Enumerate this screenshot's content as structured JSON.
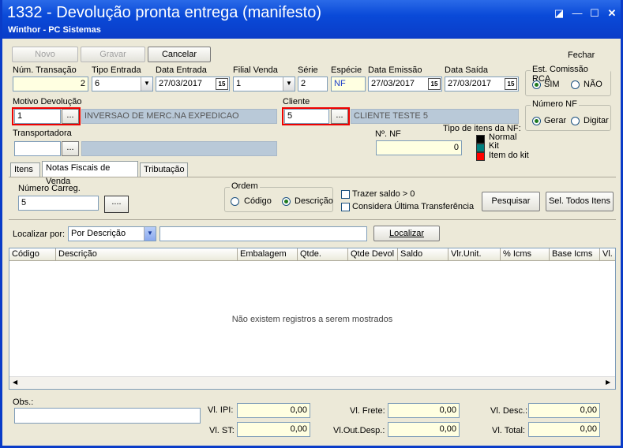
{
  "window": {
    "title": "1332 - Devolução pronta entrega (manifesto)",
    "subtitle": "Winthor - PC Sistemas"
  },
  "toolbar": {
    "novo": "Novo",
    "gravar": "Gravar",
    "cancelar": "Cancelar",
    "fechar": "Fechar"
  },
  "header": {
    "num_transacao_label": "Núm. Transação",
    "num_transacao_value": "2",
    "tipo_entrada_label": "Tipo Entrada",
    "tipo_entrada_value": "6",
    "data_entrada_label": "Data Entrada",
    "data_entrada_value": "27/03/2017",
    "filial_venda_label": "Filial Venda",
    "filial_venda_value": "1",
    "serie_label": "Série",
    "serie_value": "2",
    "especie_label": "Espécie",
    "especie_value": "NF",
    "data_emissao_label": "Data Emissão",
    "data_emissao_value": "27/03/2017",
    "data_saida_label": "Data Saída",
    "data_saida_value": "27/03/2017",
    "cal_icon": "15"
  },
  "comissao": {
    "title": "Est. Comissão RCA",
    "sim": "SIM",
    "nao": "NÃO"
  },
  "numero_nf_group": {
    "title": "Número NF",
    "gerar": "Gerar",
    "digitar": "Digitar"
  },
  "motivo": {
    "label": "Motivo Devolução",
    "code": "1",
    "desc": "INVERSAO DE MERC.NA EXPEDICAO",
    "btn": "..."
  },
  "cliente": {
    "label": "Cliente",
    "code": "5",
    "desc": "CLIENTE TESTE 5",
    "btn": "..."
  },
  "transportadora": {
    "label": "Transportadora",
    "code": "",
    "desc": "",
    "btn": "..."
  },
  "nf": {
    "label": "Nº. NF",
    "value": "0"
  },
  "tipo_itens": {
    "title": "Tipo de itens da NF:",
    "items": [
      {
        "label": "Normal",
        "color": "#000000"
      },
      {
        "label": "Kit",
        "color": "#008080"
      },
      {
        "label": "Item do kit",
        "color": "#ff0000"
      }
    ]
  },
  "tabs": [
    "Itens",
    "Notas Fiscais de Venda",
    "Tributação"
  ],
  "carreg": {
    "label": "Número Carreg.",
    "value": "5",
    "btn": "...."
  },
  "ordem": {
    "title": "Ordem",
    "codigo": "Código",
    "descricao": "Descrição"
  },
  "options": {
    "trazer_saldo": "Trazer saldo > 0",
    "considera_ultima": "Considera Última Transferência"
  },
  "buttons": {
    "pesquisar": "Pesquisar",
    "sel_todos": "Sel. Todos Itens",
    "localizar": "Localizar"
  },
  "localizar": {
    "label": "Localizar por:",
    "selected": "Por Descrição",
    "value": ""
  },
  "grid": {
    "columns": [
      "Código",
      "Descrição",
      "Embalagem",
      "Qtde.",
      "Qtde Devol",
      "Saldo",
      "Vlr.Unit.",
      "% Icms",
      "Base Icms",
      "Vl."
    ],
    "empty_message": "Não existem registros a serem mostrados"
  },
  "footer": {
    "obs_label": "Obs.:",
    "obs_value": "",
    "vl_ipi_label": "Vl. IPI:",
    "vl_ipi": "0,00",
    "vl_st_label": "Vl. ST:",
    "vl_st": "0,00",
    "vl_frete_label": "Vl. Frete:",
    "vl_frete": "0,00",
    "vl_outdesp_label": "Vl.Out.Desp.:",
    "vl_outdesp": "0,00",
    "vl_desc_label": "Vl. Desc.:",
    "vl_desc": "0,00",
    "vl_total_label": "Vl. Total:",
    "vl_total": "0,00"
  }
}
